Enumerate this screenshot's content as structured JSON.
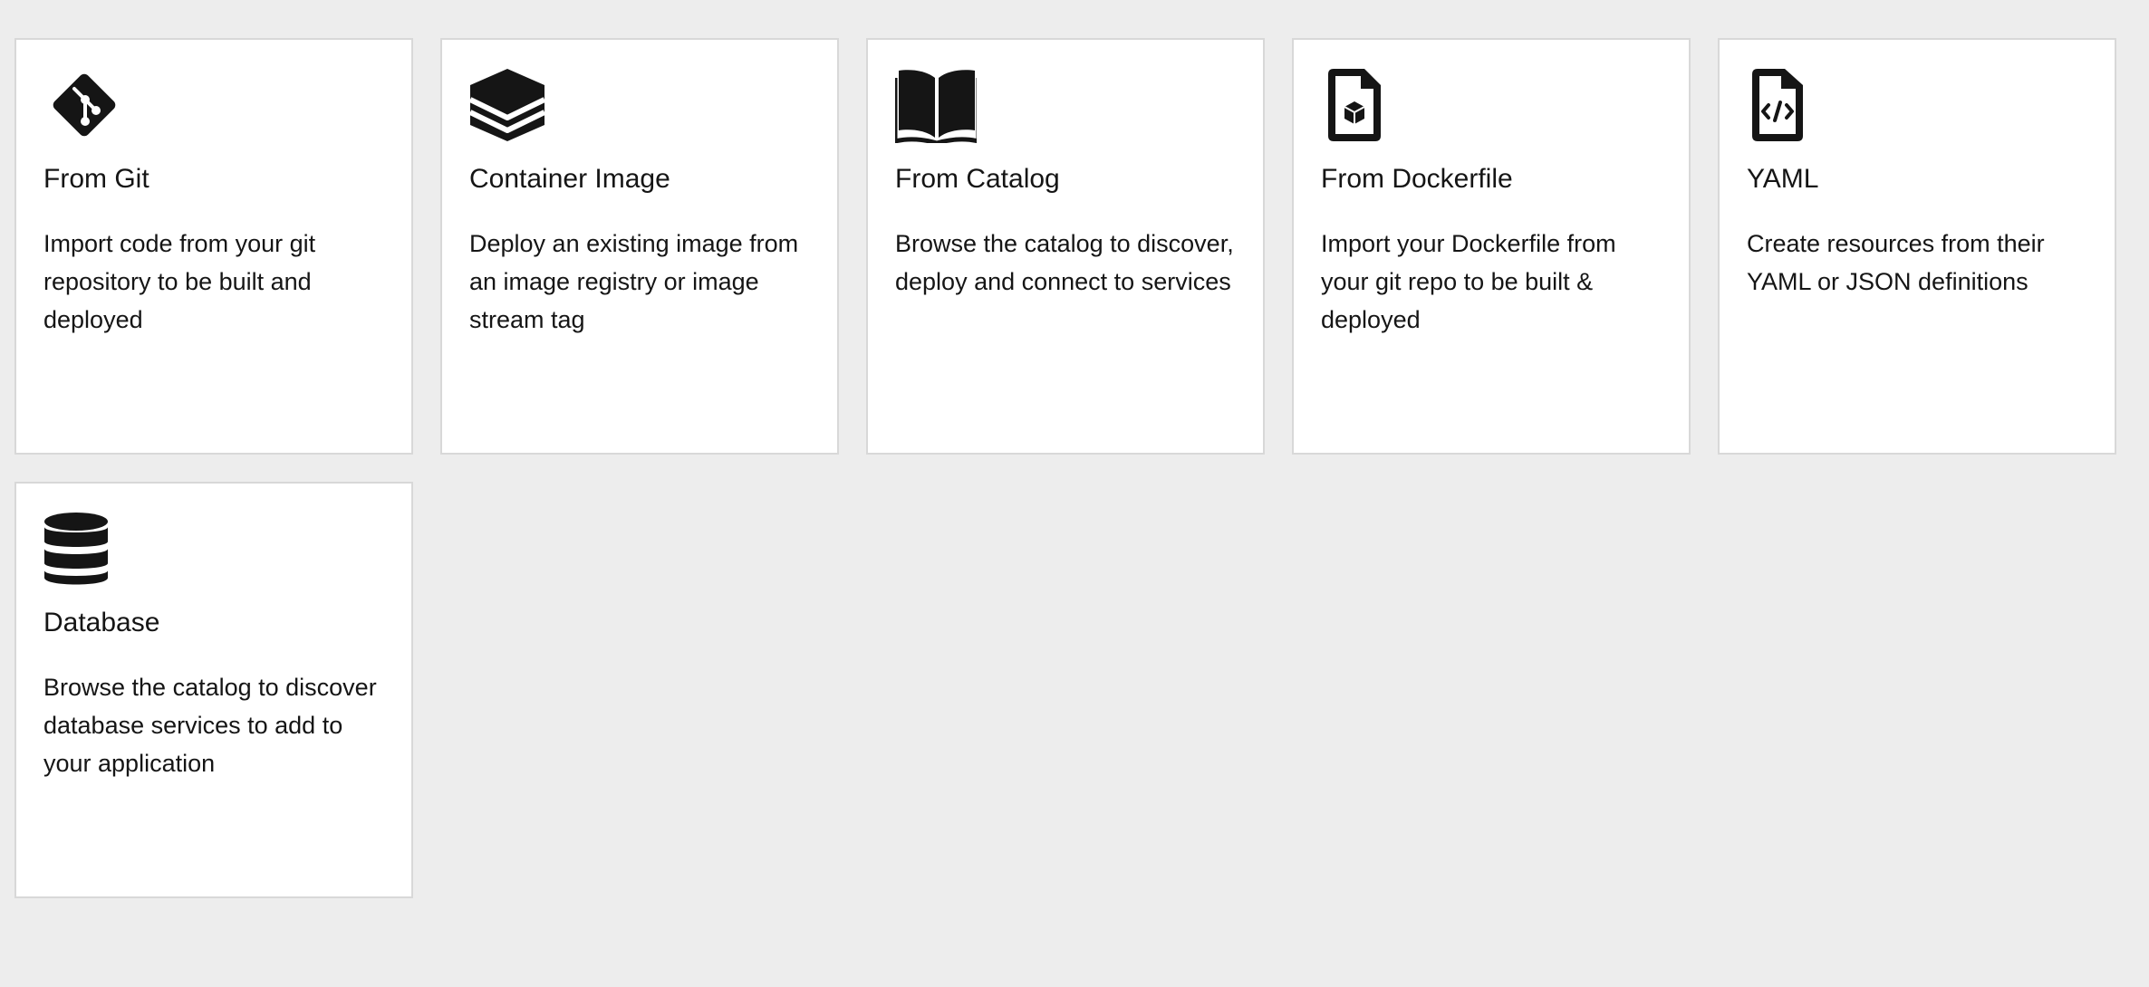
{
  "cards": [
    {
      "title": "From Git",
      "description": "Import code from your git repository to be built and deployed",
      "icon": "git-icon"
    },
    {
      "title": "Container Image",
      "description": "Deploy an existing image from an image registry or image stream tag",
      "icon": "layers-icon"
    },
    {
      "title": "From Catalog",
      "description": "Browse the catalog to discover, deploy and connect to services",
      "icon": "book-icon"
    },
    {
      "title": "From Dockerfile",
      "description": "Import your Dockerfile from your git repo to be built & deployed",
      "icon": "file-cube-icon"
    },
    {
      "title": "YAML",
      "description": "Create resources from their YAML or JSON definitions",
      "icon": "file-code-icon"
    },
    {
      "title": "Database",
      "description": "Browse the catalog to discover database services to add to your application",
      "icon": "database-icon"
    }
  ],
  "colors": {
    "background": "#ededed",
    "card": "#ffffff",
    "border": "#d8d8d8",
    "text": "#151515"
  }
}
